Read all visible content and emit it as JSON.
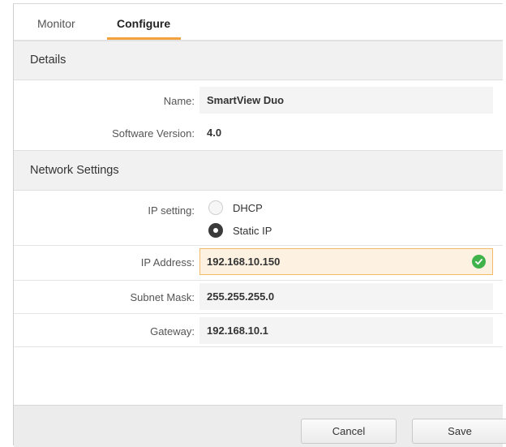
{
  "tabs": [
    {
      "label": "Monitor",
      "active": false
    },
    {
      "label": "Configure",
      "active": true
    }
  ],
  "accent_color": "#f2a13c",
  "details": {
    "title": "Details",
    "name_label": "Name:",
    "name_value": "SmartView Duo",
    "software_label": "Software Version:",
    "software_value": "4.0"
  },
  "network": {
    "title": "Network Settings",
    "ip_setting_label": "IP setting:",
    "options": [
      {
        "label": "DHCP",
        "selected": false
      },
      {
        "label": "Static IP",
        "selected": true
      }
    ],
    "ip_label": "IP Address:",
    "ip_value": "192.168.10.150",
    "ip_valid_icon": "check-circle-icon",
    "subnet_label": "Subnet Mask:",
    "subnet_value": "255.255.255.0",
    "gateway_label": "Gateway:",
    "gateway_value": "192.168.10.1"
  },
  "footer": {
    "cancel_label": "Cancel",
    "save_label": "Save"
  }
}
